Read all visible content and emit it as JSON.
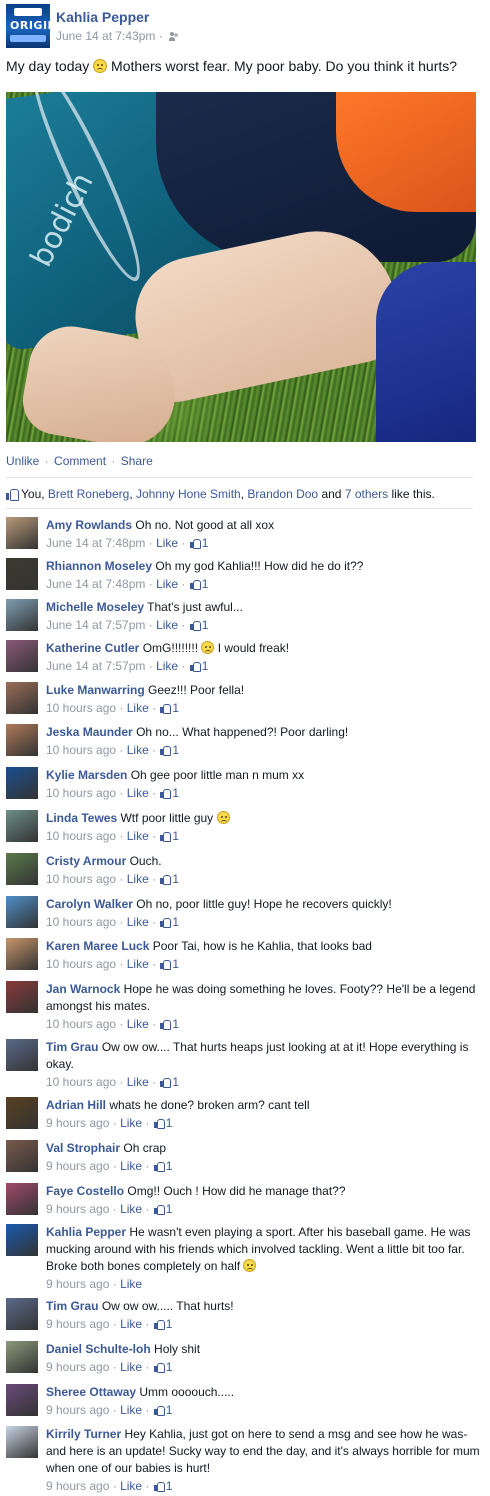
{
  "post": {
    "author": "Kahlia Pepper",
    "time": "June 14 at 7:43pm",
    "time_sep": " · ",
    "text_before": "My day today ",
    "text_after": " Mothers worst fear. My poor baby. Do you think it hurts?",
    "photo_text": "bodich"
  },
  "actions": {
    "unlike": "Unlike",
    "comment": "Comment",
    "share": "Share",
    "sep": "·"
  },
  "likes": {
    "you": "You, ",
    "people": [
      "Brett Roneberg",
      "Johnny Hone Smith",
      "Brandon Doo"
    ],
    "sep1": ", ",
    "and": " and ",
    "others": "7 others",
    "suffix": " like this."
  },
  "meta_sep": " · ",
  "like_label": "Like",
  "comments": [
    {
      "name": "Amy Rowlands",
      "text": "Oh no. Not good at all xox",
      "time": "June 14 at 7:48pm",
      "likes": "1",
      "avatar": "#b99a7a"
    },
    {
      "name": "Rhiannon Moseley",
      "text": "Oh my god Kahlia!!! How did he do it??",
      "time": "June 14 at 7:48pm",
      "likes": "1",
      "avatar": "#3d3a2e"
    },
    {
      "name": "Michelle Moseley",
      "text": "That's just awful...",
      "time": "June 14 at 7:57pm",
      "likes": "1",
      "avatar": "#7f9fb4"
    },
    {
      "name": "Katherine Cutler",
      "text": "OmG!!!!!!!! ",
      "text_after": " I would freak!",
      "emoji": true,
      "time": "June 14 at 7:57pm",
      "likes": "1",
      "avatar": "#8a5a7a"
    },
    {
      "name": "Luke Manwarring",
      "text": "Geez!!! Poor fella!",
      "time": "10 hours ago",
      "likes": "1",
      "avatar": "#9a6e58"
    },
    {
      "name": "Jeska Maunder",
      "text": "Oh no... What happened?! Poor darling!",
      "time": "10 hours ago",
      "likes": "1",
      "avatar": "#b07a5a"
    },
    {
      "name": "Kylie Marsden",
      "text": "Oh gee poor little man n mum xx",
      "time": "10 hours ago",
      "likes": "1",
      "avatar": "#1a4f8f"
    },
    {
      "name": "Linda Tewes",
      "text": "Wtf poor little guy ",
      "emoji": true,
      "time": "10 hours ago",
      "likes": "1",
      "avatar": "#6d8f87"
    },
    {
      "name": "Cristy Armour",
      "text": "Ouch.",
      "time": "10 hours ago",
      "likes": "1",
      "avatar": "#5a7a4a"
    },
    {
      "name": "Carolyn Walker",
      "text": "Oh no, poor little guy! Hope he recovers quickly!",
      "time": "10 hours ago",
      "likes": "1",
      "avatar": "#4f8fc9"
    },
    {
      "name": "Karen Maree Luck",
      "text": "Poor Tai, how is he Kahlia, that looks bad",
      "time": "10 hours ago",
      "likes": "1",
      "avatar": "#c7956a"
    },
    {
      "name": "Jan Warnock",
      "text": "Hope he was doing something he loves. Footy?? He'll be a legend amongst his mates.",
      "time": "10 hours ago",
      "likes": "1",
      "avatar": "#8a3a3a"
    },
    {
      "name": "Tim Grau",
      "text": "Ow ow ow.... That hurts heaps just looking at at it! Hope everything is okay.",
      "time": "10 hours ago",
      "likes": "1",
      "avatar": "#5a6a8a"
    },
    {
      "name": "Adrian Hill",
      "text": "whats he done? broken arm? cant tell",
      "time": "9 hours ago",
      "likes": "1",
      "avatar": "#5a4020"
    },
    {
      "name": "Val Strophair",
      "text": "Oh crap",
      "time": "9 hours ago",
      "likes": "1",
      "avatar": "#7a5a4a"
    },
    {
      "name": "Faye Costello",
      "text": "Omg!! Ouch ! How did he manage that??",
      "time": "9 hours ago",
      "likes": "1",
      "avatar": "#a04a6a"
    },
    {
      "name": "Kahlia Pepper",
      "text": "He wasn't even playing a sport. After his baseball game. He was mucking around with his friends which involved tackling. Went a little bit too far. Broke both bones completely on half ",
      "emoji": true,
      "time": "9 hours ago",
      "likes": "",
      "avatar": "#1a5aaf"
    },
    {
      "name": "Tim Grau",
      "text": "Ow ow ow..... That hurts!",
      "time": "9 hours ago",
      "likes": "1",
      "avatar": "#5a6a8a"
    },
    {
      "name": "Daniel Schulte-loh",
      "text": "Holy shit",
      "time": "9 hours ago",
      "likes": "1",
      "avatar": "#8a9a7a"
    },
    {
      "name": "Sheree Ottaway",
      "text": "Umm oooouch.....",
      "time": "9 hours ago",
      "likes": "1",
      "avatar": "#6a4a7a"
    },
    {
      "name": "Kirrily Turner",
      "text": "Hey Kahlia, just got on here to send a msg and see how he was- and here is an update! Sucky way to end the day, and it's always horrible for mum when one of our babies is hurt!",
      "time": "9 hours ago",
      "likes": "1",
      "avatar": "#c8d4e4"
    }
  ]
}
